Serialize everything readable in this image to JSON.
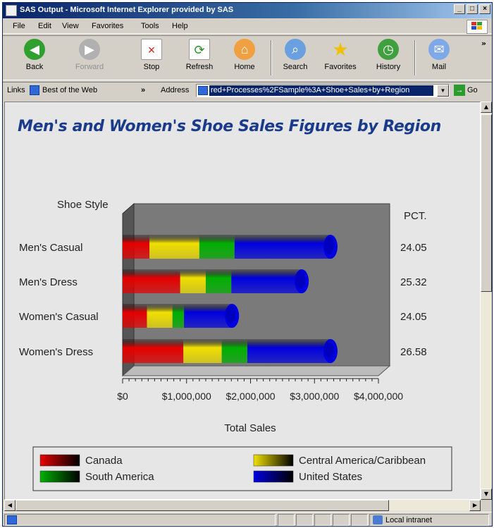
{
  "window": {
    "title": "SAS Output - Microsoft Internet Explorer provided by SAS",
    "controls": [
      "_",
      "□",
      "×"
    ]
  },
  "menu": [
    "File",
    "Edit",
    "View",
    "Favorites",
    "Tools",
    "Help"
  ],
  "toolbar": {
    "back": "Back",
    "forward": "Forward",
    "stop": "Stop",
    "refresh": "Refresh",
    "home": "Home",
    "search": "Search",
    "favorites": "Favorites",
    "history": "History",
    "mail": "Mail"
  },
  "links_bar": {
    "links_label": "Links",
    "best_of_web": "Best of the Web"
  },
  "address": {
    "label": "Address",
    "value": "red+Processes%2FSample%3A+Shoe+Sales+by+Region",
    "go_label": "Go"
  },
  "status": {
    "zone": "Local intranet"
  },
  "colors": {
    "canada": "#e60000",
    "central_america": "#f0e000",
    "south_america": "#00b000",
    "united_states": "#0000e0",
    "title": "#1a3a8c"
  },
  "chart_data": {
    "type": "bar",
    "orientation": "horizontal",
    "stacked": true,
    "title": "Men's and Women's Shoe Sales Figures by Region",
    "ylabel": "Shoe Style",
    "xlabel": "Total Sales",
    "pct_label": "PCT.",
    "categories": [
      "Men's Casual",
      "Men's Dress",
      "Women's Casual",
      "Women's Dress"
    ],
    "pct": [
      "24.05",
      "25.32",
      "24.05",
      "26.58"
    ],
    "series": [
      {
        "name": "Canada",
        "values": [
          420000,
          900000,
          380000,
          950000
        ]
      },
      {
        "name": "Central America/Caribbean",
        "values": [
          780000,
          400000,
          400000,
          600000
        ]
      },
      {
        "name": "South America",
        "values": [
          550000,
          400000,
          180000,
          400000
        ]
      },
      {
        "name": "United States",
        "values": [
          1500000,
          1100000,
          750000,
          1300000
        ]
      }
    ],
    "xlim": [
      0,
      4000000
    ],
    "xticks": [
      "$0",
      "$1,000,000",
      "$2,000,000",
      "$3,000,000",
      "$4,000,000"
    ],
    "legend": [
      "Canada",
      "Central America/Caribbean",
      "South America",
      "United States"
    ],
    "legend_placement": "bottom"
  }
}
